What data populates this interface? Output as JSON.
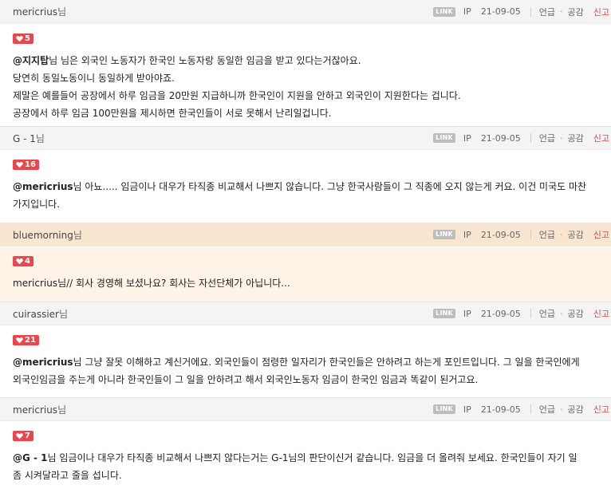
{
  "labels": {
    "link": "LINK",
    "ip": "IP",
    "mention": "언급",
    "like": "공감",
    "report": "신고",
    "dot": "·",
    "name_suffix": "님"
  },
  "comments": [
    {
      "author": "mericrius",
      "date": "21-09-05",
      "likes": "5",
      "lines": [
        {
          "mention": "@지지탑",
          "text": "님 님은 외국인 노동자가 한국인 노동자랑 동일한 임금을 받고 있다는거잖아요."
        },
        {
          "mention": "",
          "text": "당연히 동일노동이니 동일하게 받아야죠."
        },
        {
          "mention": "",
          "text": "제말은 예를들어 공장에서 하루 임금을 20만원 지급하니까 한국인이 지원을 안하고 외국인이 지원한다는 겁니다."
        },
        {
          "mention": "",
          "text": "공장에서 하루 임금 100만원을 제시하면 한국인들이 서로 못해서 난리일겁니다."
        }
      ]
    },
    {
      "author": "G - 1",
      "date": "21-09-05",
      "likes": "16",
      "lines": [
        {
          "mention": "@mericrius",
          "text": "님 아뇨..... 임금이나 대우가 타직종 비교해서 나쁘지 않습니다. 그냥 한국사람들이 그 직종에 오지 않는게 커요. 이건 미국도 마찬"
        },
        {
          "mention": "",
          "text": "가지입니다."
        }
      ]
    },
    {
      "author": "bluemorning",
      "date": "21-09-05",
      "likes": "4",
      "highlight": true,
      "lines": [
        {
          "mention": "",
          "text": "mericrius님// 회사 경영해 보셨나요? 회사는 자선단체가 아닙니다..."
        }
      ]
    },
    {
      "author": "cuirassier",
      "date": "21-09-05",
      "likes": "21",
      "lines": [
        {
          "mention": "@mericrius",
          "text": "님 그냥 잘못 이해하고 계신거에요. 외국인들이 점령한 일자리가 한국인들은 안하려고 하는게 포인트입니다. 그 일을 한국인에게"
        },
        {
          "mention": "",
          "text": "외국인임금을 주는게 아니라 한국인들이 그 일을 안하려고 해서 외국인노동자 임금이 한국인 임금과 똑같이 된거고요."
        }
      ]
    },
    {
      "author": "mericrius",
      "date": "21-09-05",
      "likes": "7",
      "lines": [
        {
          "mention": "@G - 1",
          "text": "님 임금이나 대우가 타직종 비교해서 나쁘지 않다는거는 G-1님의 판단이신거 같습니다. 임금을 더 올려줘 보세요. 한국인들이 자기 일"
        },
        {
          "mention": "",
          "text": "좀 시켜달라고 줄을 섭니다."
        }
      ]
    }
  ]
}
